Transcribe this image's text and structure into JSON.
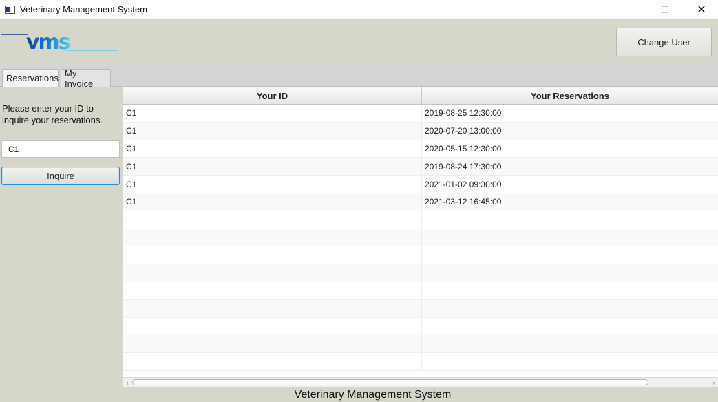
{
  "window": {
    "title": "Veterinary Management System",
    "min_icon": "minimize-icon",
    "max_icon": "maximize-icon",
    "close_icon": "close-icon",
    "close_glyph": "✕"
  },
  "header": {
    "logo_text": "vms",
    "change_user_label": "Change User"
  },
  "tabs": [
    {
      "label": "Reservations",
      "active": true
    },
    {
      "label": "My Invoice",
      "active": false
    }
  ],
  "left_panel": {
    "prompt": "Please enter your ID to inquire your reservations.",
    "id_value": "C1",
    "inquire_label": "Inquire"
  },
  "table": {
    "columns": [
      "Your ID",
      "Your Reservations"
    ],
    "rows": [
      [
        "C1",
        "2019-08-25 12:30:00"
      ],
      [
        "C1",
        "2020-07-20 13:00:00"
      ],
      [
        "C1",
        "2020-05-15 12:30:00"
      ],
      [
        "C1",
        "2019-08-24 17:30:00"
      ],
      [
        "C1",
        "2021-01-02 09:30:00"
      ],
      [
        "C1",
        "2021-03-12 16:45:00"
      ],
      [
        "",
        ""
      ],
      [
        "",
        ""
      ],
      [
        "",
        ""
      ],
      [
        "",
        ""
      ],
      [
        "",
        ""
      ],
      [
        "",
        ""
      ],
      [
        "",
        ""
      ],
      [
        "",
        ""
      ],
      [
        "",
        ""
      ]
    ]
  },
  "scrollbar": {
    "left_arrow": "‹",
    "right_arrow": "›"
  },
  "footer": {
    "text": "Veterinary Management System"
  },
  "colors": {
    "accent_focus": "#2a8ad8",
    "logo_blue": "#1a9fd6",
    "logo_dark": "#143f9e"
  }
}
